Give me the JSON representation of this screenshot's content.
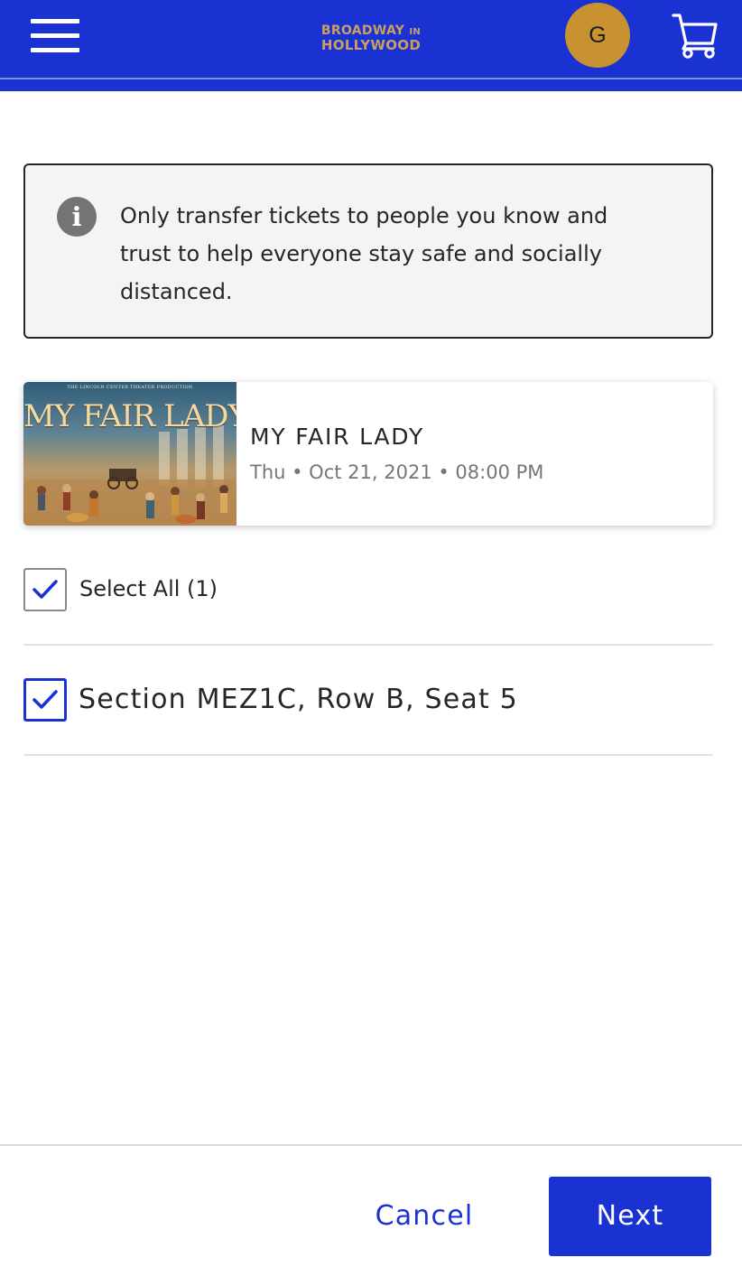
{
  "header": {
    "logo_line1": "BROADWAY",
    "logo_line1_small": "IN",
    "logo_line2": "HOLLYWOOD",
    "avatar_initial": "G",
    "icons": [
      "hamburger-menu-icon",
      "cart-icon"
    ],
    "colors": {
      "brand_blue": "#1a32d2",
      "avatar_gold": "#c99230",
      "logo_gold": "#c9a060"
    }
  },
  "notice": {
    "icon": "info-icon",
    "text": "Only transfer tickets to people you know and trust to help everyone stay safe and socially distanced."
  },
  "event": {
    "poster_credit": "THE LINCOLN CENTER THEATER PRODUCTION",
    "poster_title": "MY FAIR LADY",
    "title": "MY FAIR LADY",
    "date": "Thu • Oct 21, 2021 • 08:00 PM"
  },
  "selection": {
    "select_all_label": "Select All (1)",
    "select_all_checked": true,
    "seats": [
      {
        "label": "Section MEZ1C, Row B, Seat 5",
        "checked": true
      }
    ]
  },
  "footer": {
    "cancel_label": "Cancel",
    "next_label": "Next"
  }
}
